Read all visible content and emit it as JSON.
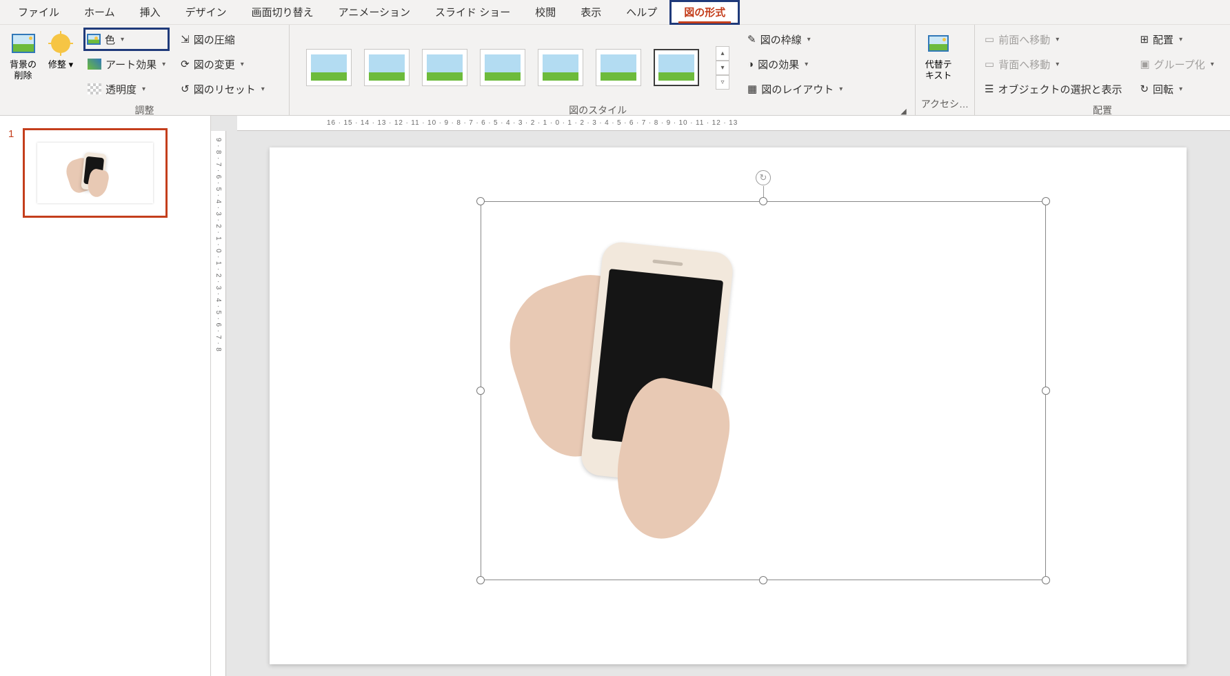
{
  "tabs": {
    "file": "ファイル",
    "home": "ホーム",
    "insert": "挿入",
    "design": "デザイン",
    "transitions": "画面切り替え",
    "animations": "アニメーション",
    "slideshow": "スライド ショー",
    "review": "校閲",
    "view": "表示",
    "help": "ヘルプ",
    "picture_format": "図の形式"
  },
  "ribbon": {
    "adjust": {
      "remove_bg": "背景の\n削除",
      "corrections": "修整",
      "color": "色",
      "artistic": "アート効果",
      "transparency": "透明度",
      "compress": "図の圧縮",
      "change": "図の変更",
      "reset": "図のリセット",
      "group_label": "調整"
    },
    "styles": {
      "border": "図の枠線",
      "effects": "図の効果",
      "layout": "図のレイアウト",
      "group_label": "図のスタイル"
    },
    "accessibility": {
      "alt_text": "代替テ\nキスト",
      "group_label": "アクセシ…"
    },
    "arrange": {
      "bring_forward": "前面へ移動",
      "send_backward": "背面へ移動",
      "selection_pane": "オブジェクトの選択と表示",
      "align": "配置",
      "group": "グループ化",
      "rotate": "回転",
      "group_label": "配置"
    }
  },
  "slide": {
    "number": "1"
  },
  "ruler_h": "16 ∙ 15 ∙ 14 ∙ 13 ∙ 12 ∙ 11 ∙ 10 ∙ 9 ∙ 8 ∙ 7 ∙ 6 ∙ 5 ∙ 4 ∙ 3 ∙ 2 ∙ 1 ∙ 0 ∙ 1 ∙ 2 ∙ 3 ∙ 4 ∙ 5 ∙ 6 ∙ 7 ∙ 8 ∙ 9 ∙ 10 ∙ 11 ∙ 12 ∙ 13",
  "ruler_v": "9 ∙ 8 ∙ 7 ∙ 6 ∙ 5 ∙ 4 ∙ 3 ∙ 2 ∙ 1 ∙ 0 ∙ 1 ∙ 2 ∙ 3 ∙ 4 ∙ 5 ∙ 6 ∙ 7 ∙ 8"
}
